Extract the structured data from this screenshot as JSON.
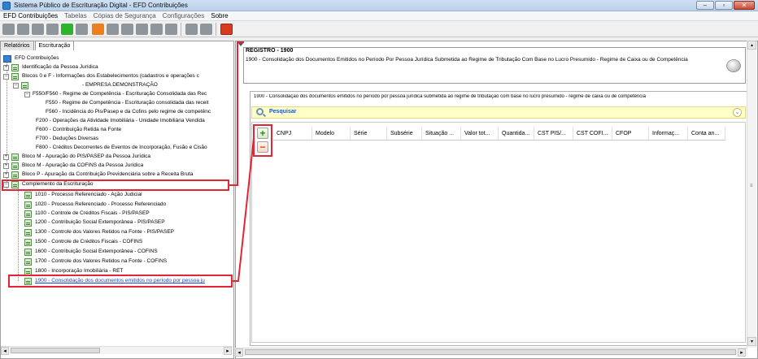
{
  "window": {
    "title": "Sistema Público de Escrituração Digital - EFD Contribuições"
  },
  "menu": [
    {
      "label": "EFD Contribuições"
    },
    {
      "label": "Tabelas"
    },
    {
      "label": "Cópias de Segurança"
    },
    {
      "label": "Configurações"
    },
    {
      "label": "Sobre"
    }
  ],
  "tabs": {
    "left": [
      {
        "label": "Relatórios"
      },
      {
        "label": "Escrituração"
      }
    ]
  },
  "tree": {
    "root": "EFD Contribuições",
    "items": [
      {
        "label": "Identificação da Pessoa Jurídica"
      },
      {
        "label": "Blocos 0 e F - Informações dos Estabelecimentos (cadastros e operações c"
      },
      {
        "label": "- EMPRESA DEMONSTRAÇÃO"
      },
      {
        "label": "F550/F560 - Regime de Competência - Escrituração Consolidada das Rec"
      },
      {
        "label": "F550 - Regime de Competência - Escrituração consolidada das receit"
      },
      {
        "label": "F560 - Incidência do Pis/Pasep e da Cofins pelo regime de competênc"
      },
      {
        "label": "F200 - Operações da Atividade Imobiliária - Unidade Imobiliária Vendida"
      },
      {
        "label": "F600 - Contribuição Retida na Fonte"
      },
      {
        "label": "F700 - Deduções Diversas"
      },
      {
        "label": "F800 - Créditos Decorrentes de Eventos de Incorporação, Fusão e Cisão"
      },
      {
        "label": "Bloco M - Apuração do PIS/PASEP da Pessoa Jurídica"
      },
      {
        "label": "Bloco M - Apuração da COFINS da Pessoa Jurídica"
      },
      {
        "label": "Bloco P - Apuração da Contribuição Previdenciária sobre a Receita Bruta"
      },
      {
        "label": "Complemento da Escrituração"
      },
      {
        "label": "1010 - Processo Referenciado - Ação Judicial"
      },
      {
        "label": "1020 - Processo Referenciado - Processo Referenciado"
      },
      {
        "label": "1100 - Controle de Créditos Fiscais - PIS/PASEP"
      },
      {
        "label": "1200 - Contribuição Social Extemporânea - PIS/PASEP"
      },
      {
        "label": "1300 - Controle dos Valores Retidos na Fonte - PIS/PASEP"
      },
      {
        "label": "1500 - Controle de Créditos Fiscais - COFINS"
      },
      {
        "label": "1600 - Contribuição Social Extemporânea - COFINS"
      },
      {
        "label": "1700 - Controle dos Valores Retidos na Fonte - COFINS"
      },
      {
        "label": "1800 - Incorporação Imobiliária - RET"
      },
      {
        "label": "1900 - Consolidação dos documentos emitidos no período por pessoa ju"
      }
    ]
  },
  "register": {
    "title": "REGISTRO - 1900",
    "description": "1900 - Consolidação dos Documentos Emitidos no Período Por Pessoa Jurídica Submetida ao Regime de Tributação Com Base no Lucro Presumido - Regime de Caixa ou de Competência"
  },
  "subpanel": {
    "title": "1900 - Consolidação dos documentos emitidos no período por pessoa jurídica submetida ao regime de tributação com base no lucro presumido - regime de caixa ou de competência",
    "search_label": "Pesquisar",
    "columns": [
      {
        "label": "CNPJ"
      },
      {
        "label": "Modelo"
      },
      {
        "label": "Série"
      },
      {
        "label": "Subsérie"
      },
      {
        "label": "Situação ..."
      },
      {
        "label": "Valor tot..."
      },
      {
        "label": "Quantida..."
      },
      {
        "label": "CST PIS/..."
      },
      {
        "label": "CST COFI..."
      },
      {
        "label": "CFOP"
      },
      {
        "label": "Informaç..."
      },
      {
        "label": "Conta an..."
      }
    ]
  },
  "colors": {
    "highlight": "#e32636",
    "search_bg": "#ffffc8",
    "link": "#1a3fbf"
  },
  "icons": [
    "search-icon",
    "plus-icon",
    "minus-icon",
    "chevron-down-icon",
    "register-icon",
    "folder-icon"
  ]
}
